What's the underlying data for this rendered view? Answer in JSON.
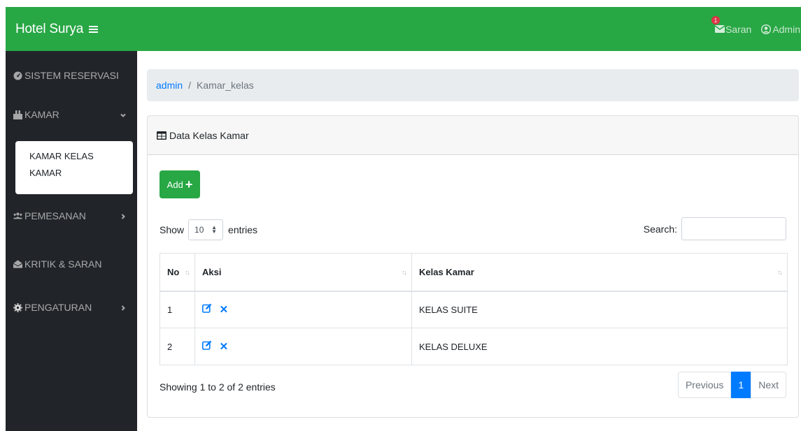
{
  "navbar": {
    "brand": "Hotel Surya",
    "badge_count": "1",
    "saran_label": "Saran",
    "admin_label": "Admin",
    "color": "#28a745"
  },
  "sidebar": {
    "items": [
      {
        "label": "SISTEM RESERVASI",
        "icon": "dashboard-icon"
      },
      {
        "label": "KAMAR",
        "icon": "hotel-icon",
        "expanded": true
      },
      {
        "label": "PEMESANAN",
        "icon": "users-icon"
      },
      {
        "label": "KRITIK & SARAN",
        "icon": "envelope-open-icon"
      },
      {
        "label": "PENGATURAN",
        "icon": "cog-icon"
      }
    ],
    "submenu": [
      "KAMAR KELAS",
      "KAMAR"
    ]
  },
  "breadcrumb": {
    "root": "admin",
    "separator": "/",
    "current": "Kamar_kelas"
  },
  "card": {
    "title": "Data Kelas Kamar",
    "add_label": "Add",
    "show_label": "Show",
    "entries_value": "10",
    "entries_label": "entries",
    "search_label": "Search:",
    "search_value": ""
  },
  "table": {
    "headers": [
      "No",
      "Aksi",
      "Kelas Kamar"
    ],
    "rows": [
      {
        "no": "1",
        "kelas": "KELAS SUITE"
      },
      {
        "no": "2",
        "kelas": "KELAS DELUXE"
      }
    ]
  },
  "footer": {
    "info": "Showing 1 to 2 of 2 entries",
    "prev": "Previous",
    "page": "1",
    "next": "Next"
  }
}
